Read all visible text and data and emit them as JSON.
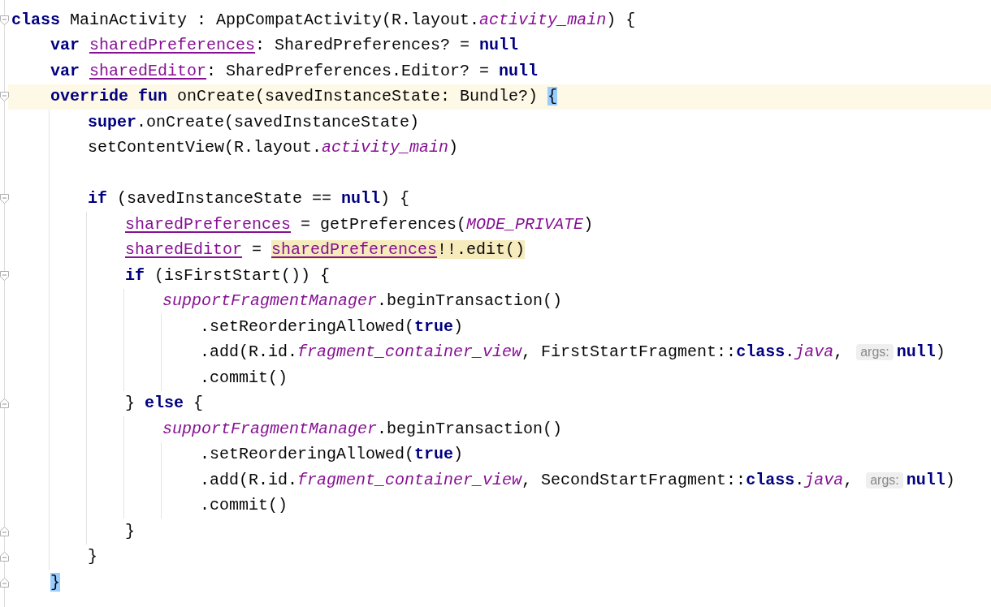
{
  "editor": {
    "lines": [
      {
        "fold_start": true,
        "fold_end": false,
        "current": false,
        "tokens": [
          {
            "text": "class",
            "kind": "keyword"
          },
          {
            "text": " MainActivity : AppCompatActivity(R.layout.",
            "kind": "plain"
          },
          {
            "text": "activity_main",
            "kind": "static"
          },
          {
            "text": ") {",
            "kind": "plain"
          }
        ]
      },
      {
        "fold_start": false,
        "fold_end": false,
        "current": false,
        "tokens": [
          {
            "text": "    var ",
            "kind": "keyword"
          },
          {
            "text": "sharedPreferences",
            "kind": "field"
          },
          {
            "text": ": SharedPreferences? = ",
            "kind": "plain"
          },
          {
            "text": "null",
            "kind": "keyword"
          }
        ]
      },
      {
        "fold_start": false,
        "fold_end": false,
        "current": false,
        "tokens": [
          {
            "text": "    var ",
            "kind": "keyword"
          },
          {
            "text": "sharedEditor",
            "kind": "field"
          },
          {
            "text": ": SharedPreferences.Editor? = ",
            "kind": "plain"
          },
          {
            "text": "null",
            "kind": "keyword"
          }
        ]
      },
      {
        "fold_start": true,
        "fold_end": false,
        "current": true,
        "tokens": [
          {
            "text": "    override fun",
            "kind": "keyword"
          },
          {
            "text": " onCreate(savedInstanceState: Bundle?) ",
            "kind": "plain"
          },
          {
            "text": "{",
            "kind": "plain",
            "matched": true
          }
        ]
      },
      {
        "fold_start": false,
        "fold_end": false,
        "current": false,
        "tokens": [
          {
            "text": "        super",
            "kind": "keyword"
          },
          {
            "text": ".onCreate(savedInstanceState)",
            "kind": "plain"
          }
        ]
      },
      {
        "fold_start": false,
        "fold_end": false,
        "current": false,
        "tokens": [
          {
            "text": "        setContentView(R.layout.",
            "kind": "plain"
          },
          {
            "text": "activity_main",
            "kind": "static"
          },
          {
            "text": ")",
            "kind": "plain"
          }
        ]
      },
      {
        "fold_start": false,
        "fold_end": false,
        "current": false
      },
      {
        "fold_start": true,
        "fold_end": false,
        "current": false,
        "tokens": [
          {
            "text": "        if",
            "kind": "keyword"
          },
          {
            "text": " (savedInstanceState == ",
            "kind": "plain"
          },
          {
            "text": "null",
            "kind": "keyword"
          },
          {
            "text": ") {",
            "kind": "plain"
          }
        ]
      },
      {
        "fold_start": false,
        "fold_end": false,
        "current": false,
        "tokens": [
          {
            "text": "            sharedPreferences",
            "kind": "field"
          },
          {
            "text": " = getPreferences(",
            "kind": "plain"
          },
          {
            "text": "MODE_PRIVATE",
            "kind": "static"
          },
          {
            "text": ")",
            "kind": "plain"
          }
        ]
      },
      {
        "fold_start": false,
        "fold_end": false,
        "current": false,
        "tokens": [
          {
            "text": "            sharedEditor",
            "kind": "field"
          },
          {
            "text": " = ",
            "kind": "plain"
          },
          {
            "text": "sharedPreferences",
            "kind": "field",
            "highlighted": true
          },
          {
            "text": "!!.edit()",
            "kind": "plain",
            "highlighted": true
          }
        ]
      },
      {
        "fold_start": true,
        "fold_end": false,
        "current": false,
        "tokens": [
          {
            "text": "            if",
            "kind": "keyword"
          },
          {
            "text": " (isFirstStart()) {",
            "kind": "plain"
          }
        ]
      },
      {
        "fold_start": false,
        "fold_end": false,
        "current": false,
        "tokens": [
          {
            "text": "                supportFragmentManager",
            "kind": "static"
          },
          {
            "text": ".beginTransaction()",
            "kind": "plain"
          }
        ]
      },
      {
        "fold_start": false,
        "fold_end": false,
        "current": false,
        "tokens": [
          {
            "text": "                    .setReorderingAllowed(",
            "kind": "plain"
          },
          {
            "text": "true",
            "kind": "keyword"
          },
          {
            "text": ")",
            "kind": "plain"
          }
        ]
      },
      {
        "fold_start": false,
        "fold_end": false,
        "current": false,
        "tokens": [
          {
            "text": "                    .add(R.id.",
            "kind": "plain"
          },
          {
            "text": "fragment_container_view",
            "kind": "static"
          },
          {
            "text": ", FirstStartFragment::",
            "kind": "plain"
          },
          {
            "text": "class",
            "kind": "keyword"
          },
          {
            "text": ".",
            "kind": "plain"
          },
          {
            "text": "java",
            "kind": "static"
          },
          {
            "text": ", ",
            "kind": "plain"
          },
          {
            "text": "args:",
            "kind": "hint"
          },
          {
            "text": "null",
            "kind": "keyword"
          },
          {
            "text": ")",
            "kind": "plain"
          }
        ]
      },
      {
        "fold_start": false,
        "fold_end": false,
        "current": false,
        "tokens": [
          {
            "text": "                    .commit()",
            "kind": "plain"
          }
        ]
      },
      {
        "fold_start": false,
        "fold_end": true,
        "current": false,
        "tokens": [
          {
            "text": "            } ",
            "kind": "plain"
          },
          {
            "text": "else",
            "kind": "keyword"
          },
          {
            "text": " {",
            "kind": "plain"
          }
        ]
      },
      {
        "fold_start": false,
        "fold_end": false,
        "current": false,
        "tokens": [
          {
            "text": "                supportFragmentManager",
            "kind": "static"
          },
          {
            "text": ".beginTransaction()",
            "kind": "plain"
          }
        ]
      },
      {
        "fold_start": false,
        "fold_end": false,
        "current": false,
        "tokens": [
          {
            "text": "                    .setReorderingAllowed(",
            "kind": "plain"
          },
          {
            "text": "true",
            "kind": "keyword"
          },
          {
            "text": ")",
            "kind": "plain"
          }
        ]
      },
      {
        "fold_start": false,
        "fold_end": false,
        "current": false,
        "tokens": [
          {
            "text": "                    .add(R.id.",
            "kind": "plain"
          },
          {
            "text": "fragment_container_view",
            "kind": "static"
          },
          {
            "text": ", SecondStartFragment::",
            "kind": "plain"
          },
          {
            "text": "class",
            "kind": "keyword"
          },
          {
            "text": ".",
            "kind": "plain"
          },
          {
            "text": "java",
            "kind": "static"
          },
          {
            "text": ", ",
            "kind": "plain"
          },
          {
            "text": "args:",
            "kind": "hint"
          },
          {
            "text": "null",
            "kind": "keyword"
          },
          {
            "text": ")",
            "kind": "plain"
          }
        ]
      },
      {
        "fold_start": false,
        "fold_end": false,
        "current": false,
        "tokens": [
          {
            "text": "                    .commit()",
            "kind": "plain"
          }
        ]
      },
      {
        "fold_start": false,
        "fold_end": true,
        "current": false,
        "tokens": [
          {
            "text": "            }",
            "kind": "plain"
          }
        ]
      },
      {
        "fold_start": false,
        "fold_end": true,
        "current": false,
        "tokens": [
          {
            "text": "        }",
            "kind": "plain"
          }
        ]
      },
      {
        "fold_start": false,
        "fold_end": true,
        "current": false,
        "tokens": [
          {
            "text": "    }",
            "kind": "plain",
            "matched": true
          }
        ]
      }
    ]
  }
}
